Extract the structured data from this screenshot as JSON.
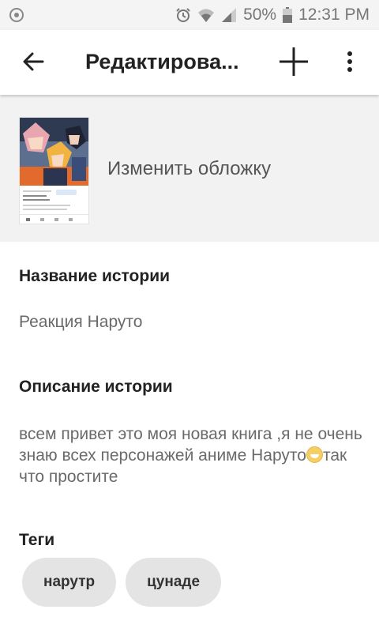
{
  "status_bar": {
    "battery": "50%",
    "time": "12:31 PM"
  },
  "app_bar": {
    "title": "Редактирова..."
  },
  "cover": {
    "change_label": "Изменить обложку"
  },
  "story_title": {
    "label": "Название истории",
    "value": "Реакция Наруто"
  },
  "story_description": {
    "label": "Описание истории",
    "text_before_emoji": "всем привет это моя новая книга ,я не очень знаю всех персонажей  аниме Наруто",
    "text_after_emoji": "так что простите"
  },
  "tags": {
    "label": "Теги",
    "items": [
      "нарутр",
      "цунаде"
    ]
  },
  "icons": [
    "chrome-icon",
    "alarm-icon",
    "wifi-icon",
    "signal-icon",
    "battery-icon",
    "back-arrow-icon",
    "plus-icon",
    "more-vert-icon",
    "grin-emoji-icon"
  ]
}
